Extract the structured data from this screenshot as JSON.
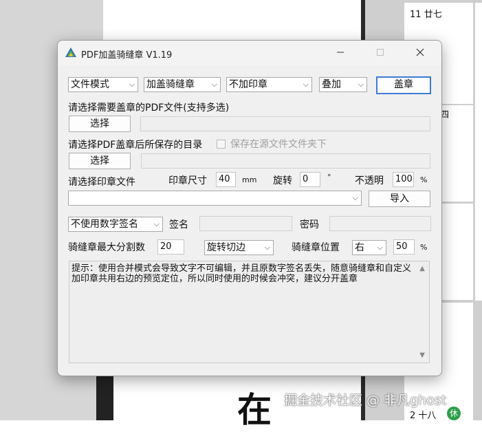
{
  "window": {
    "title": "PDF加盖骑缝章 V1.19"
  },
  "row1": {
    "mode": "文件模式",
    "seal_type": "加盖骑缝章",
    "stamp": "不加印章",
    "overlay": "叠加",
    "stamp_button": "盖章"
  },
  "pdf_select": {
    "label": "请选择需要盖章的PDF文件(支持多选)",
    "button": "选择"
  },
  "save_dir": {
    "label": "请选择PDF盖章后所保存的目录",
    "checkbox_label": "保存在源文件文件夹下",
    "button": "选择"
  },
  "stamp_file": {
    "label": "请选择印章文件",
    "size_label": "印章尺寸",
    "size_value": "40",
    "size_unit": "mm",
    "rotate_label": "旋转",
    "rotate_value": "0",
    "rotate_unit": "°",
    "opacity_label": "不透明",
    "opacity_value": "100",
    "opacity_unit": "%",
    "import_button": "导入"
  },
  "signature": {
    "mode": "不使用数字签名",
    "name_label": "签名",
    "password_label": "密码"
  },
  "split": {
    "max_label": "骑缝章最大分割数",
    "max_value": "20",
    "edge_mode": "旋转切边",
    "position_label": "骑缝章位置",
    "position_value": "右",
    "percent_value": "50",
    "percent_unit": "%"
  },
  "tip": "提示：使用合并模式会导致文字不可编辑，并且原数字签名丢失，随意骑缝章和自定义加印章共用右边的预览定位，所以同时使用的时候会冲突，建议分开盖章",
  "background": {
    "cal_1": "11",
    "cal_1_lunar": "廿七",
    "cal_2": "四",
    "cal_3": "2",
    "cal_3_lunar": "十八",
    "holiday_badge": "休",
    "big_char": "在",
    "watermark": "掘金技术社区 @ 非凡ghost"
  }
}
